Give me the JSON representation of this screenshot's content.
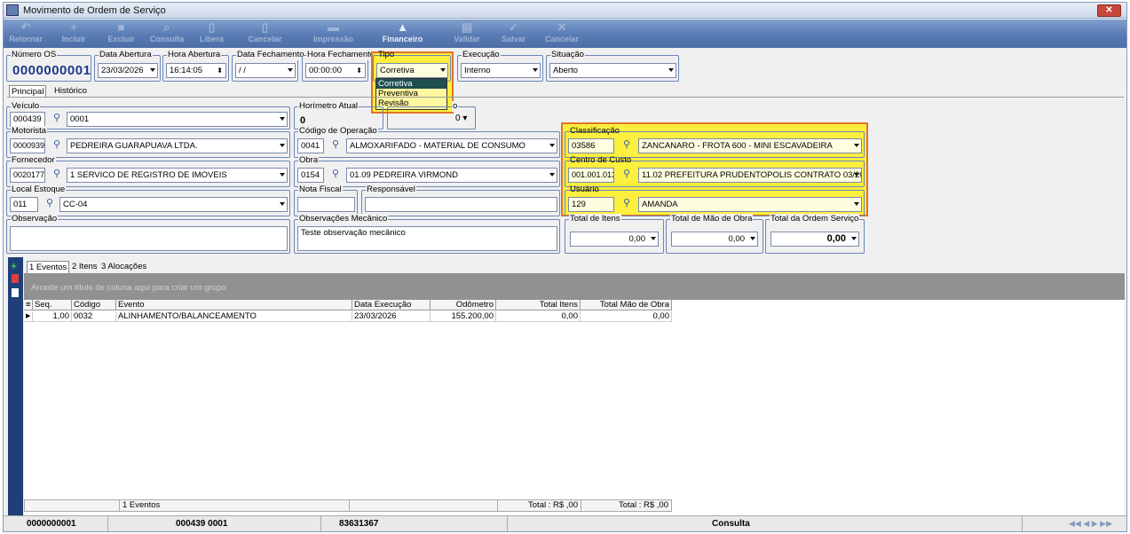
{
  "window": {
    "title": "Movimento de Ordem de Serviço",
    "close": "✕"
  },
  "toolbar": [
    {
      "label": "Retornar",
      "icon": "↶",
      "enabled": false
    },
    {
      "label": "Incluir",
      "icon": "+",
      "enabled": false
    },
    {
      "label": "Excluir",
      "icon": "■",
      "enabled": false
    },
    {
      "label": "Consulta",
      "icon": "⌕",
      "enabled": false
    },
    {
      "label": "Libera",
      "icon": "▯",
      "enabled": false
    },
    {
      "label": "Cancelar",
      "icon": "▯",
      "enabled": false
    },
    {
      "label": "Impressão",
      "icon": "▬",
      "enabled": false
    },
    {
      "label": "Financeiro",
      "icon": "▲",
      "enabled": true
    },
    {
      "label": "Validar",
      "icon": "▤",
      "enabled": false
    },
    {
      "label": "Salvar",
      "icon": "✓",
      "enabled": false
    },
    {
      "label": "Cancelar",
      "icon": "✕",
      "enabled": false
    }
  ],
  "header": {
    "numero_os": {
      "label": "Número OS",
      "value": "0000000001"
    },
    "data_abertura": {
      "label": "Data Abertura",
      "value": "23/03/2026"
    },
    "hora_abertura": {
      "label": "Hora Abertura",
      "value": "16:14:05"
    },
    "data_fechamento": {
      "label": "Data Fechamento",
      "value": "/ /"
    },
    "hora_fechamento": {
      "label": "Hora Fechamento",
      "value": "00:00:00"
    },
    "tipo": {
      "label": "Tipo",
      "value": "Corretiva",
      "options": [
        "Corretiva",
        "Preventiva",
        "Revisão"
      ]
    },
    "execucao": {
      "label": "Execução",
      "value": "Interno"
    },
    "situacao": {
      "label": "Situação",
      "value": "Aberto"
    }
  },
  "tabs": [
    "Principal",
    "Histórico"
  ],
  "form": {
    "veiculo": {
      "label": "Veículo",
      "code": "000439",
      "value": "0001"
    },
    "horimetro": {
      "label": "Horímetro Atual",
      "value": "0"
    },
    "hodometro": {
      "label": "o",
      "value": "0"
    },
    "motorista": {
      "label": "Motorista",
      "code": "0000939",
      "value": "PEDREIRA GUARAPUAVA LTDA."
    },
    "codigo_operacao": {
      "label": "Código de Operação",
      "code": "0041",
      "value": "ALMOXARIFADO - MATERIAL DE CONSUMO"
    },
    "classificacao": {
      "label": "Classificação",
      "code": "03586",
      "value": "ZANCANARO - FROTA 600 - MINI ESCAVADEIRA"
    },
    "fornecedor": {
      "label": "Fornecedor",
      "code": "0020177",
      "value": "1 SERVICO DE REGISTRO DE IMOVEIS"
    },
    "obra": {
      "label": "Obra",
      "code": "0154",
      "value": "01.09 PEDREIRA VIRMOND"
    },
    "centro_custo": {
      "label": "Centro de Custo",
      "code": "001.001.013",
      "value": "11.02 PREFEITURA PRUDENTOPOLIS CONTRATO 03/201:"
    },
    "local_estoque": {
      "label": "Local Estoque",
      "code": "011",
      "value": "CC-04"
    },
    "nota_fiscal": {
      "label": "Nota Fiscal",
      "value": ""
    },
    "responsavel": {
      "label": "Responsável",
      "value": ""
    },
    "usuario": {
      "label": "Usuário",
      "code": "129",
      "value": "AMANDA"
    },
    "observacao": {
      "label": "Observação",
      "value": ""
    },
    "obs_mecanico": {
      "label": "Observações Mecânico",
      "value": "Teste observação mecânico"
    },
    "total_itens": {
      "label": "Total de Itens",
      "value": "0,00"
    },
    "total_mao_obra": {
      "label": "Total de Mão de Obra",
      "value": "0,00"
    },
    "total_os": {
      "label": "Total da Ordem Serviço",
      "value": "0,00"
    }
  },
  "subtabs": [
    "1 Eventos",
    "2 Itens",
    "3 Alocações"
  ],
  "grid": {
    "group_hint": "Arraste um título de coluna aqui para criar um grupo",
    "columns": [
      "Seq.",
      "Código",
      "Evento",
      "Data Execução",
      "Odômetro",
      "Total Itens",
      "Total Mão de Obra"
    ],
    "rows": [
      [
        "1,00",
        "0032",
        "ALINHAMENTO/BALANCEAMENTO",
        "23/03/2026",
        "155.200,00",
        "0,00",
        "0,00"
      ]
    ],
    "footer": {
      "count": "1 Eventos",
      "total_itens": "Total : R$ ,00",
      "total_mao": "Total : R$ ,00"
    }
  },
  "statusbar": {
    "os": "0000000001",
    "veiculo": "000439 0001",
    "id": "83631367",
    "mode": "Consulta",
    "nav": "◀◀ ◀ ▶ ▶▶"
  }
}
